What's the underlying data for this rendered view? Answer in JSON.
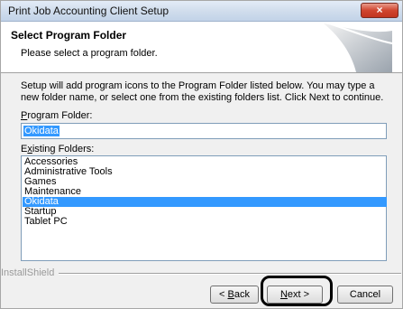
{
  "window": {
    "title": "Print Job Accounting Client Setup",
    "close_label": "×"
  },
  "header": {
    "title": "Select Program Folder",
    "subtitle": "Please select a program folder."
  },
  "main": {
    "description": "Setup will add program icons to the Program Folder listed below.  You may type a new folder name, or select one from the existing folders list.  Click Next to continue.",
    "program_folder_label_key": "P",
    "program_folder_label_rest": "rogram Folder:",
    "program_folder_value": "Okidata",
    "existing_folders_label_start": "E",
    "existing_folders_label_key": "x",
    "existing_folders_label_rest": "isting Folders:",
    "existing_folders": [
      "Accessories",
      "Administrative Tools",
      "Games",
      "Maintenance",
      "Okidata",
      "Startup",
      "Tablet PC"
    ],
    "selected_folder": "Okidata"
  },
  "footer": {
    "brand": "InstallShield",
    "back_prefix": "< ",
    "back_key": "B",
    "back_rest": "ack",
    "next_key": "N",
    "next_rest": "ext >",
    "cancel_label": "Cancel"
  }
}
